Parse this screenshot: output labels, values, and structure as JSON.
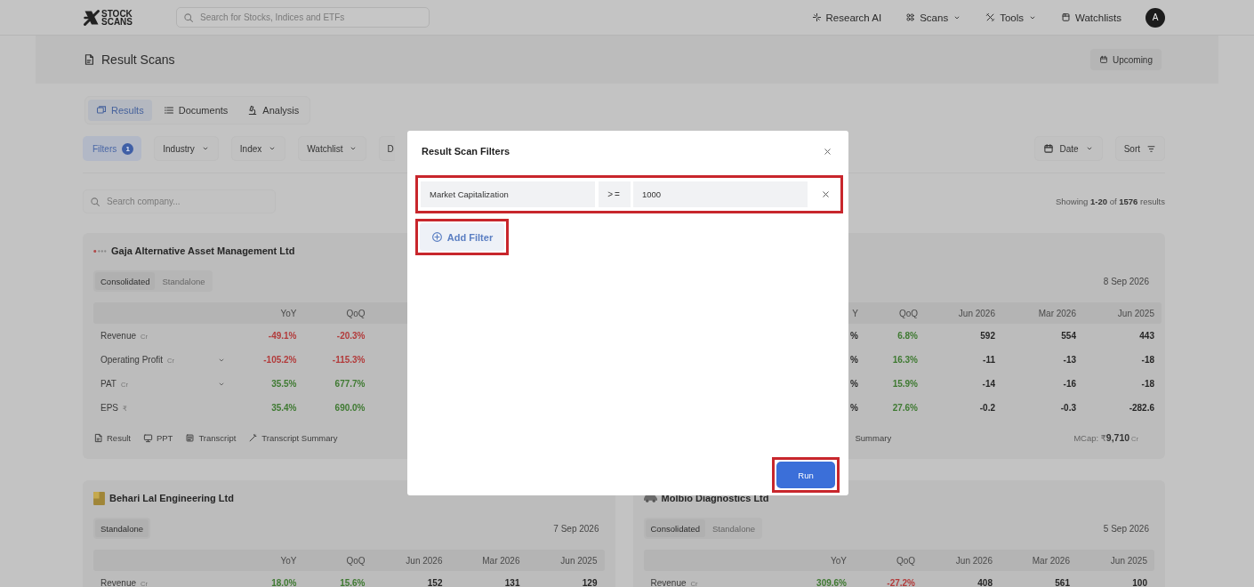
{
  "nav": {
    "logo": [
      "STOCK",
      "SCANS"
    ],
    "search_placeholder": "Search for Stocks, Indices and ETFs",
    "items": [
      {
        "label": "Research AI",
        "kind": "ai",
        "dropdown": false
      },
      {
        "label": "Scans",
        "kind": "scans",
        "dropdown": true
      },
      {
        "label": "Tools",
        "kind": "tools",
        "dropdown": true
      },
      {
        "label": "Watchlists",
        "kind": "watchlists",
        "dropdown": false
      }
    ],
    "avatar": "A"
  },
  "page_header": {
    "title": "Result Scans",
    "upcoming_button": "Upcoming"
  },
  "tabs": [
    {
      "label": "Results",
      "kind": "results",
      "selected": true
    },
    {
      "label": "Documents",
      "kind": "documents",
      "selected": false
    },
    {
      "label": "Analysis",
      "kind": "analysis",
      "selected": false
    }
  ],
  "filter_bar": {
    "filters_label": "Filters",
    "filters_count": "1",
    "dropdowns": [
      {
        "label": "Industry",
        "truncated": false
      },
      {
        "label": "Index",
        "truncated": false
      },
      {
        "label": "Watchlist",
        "truncated": false
      },
      {
        "label": "D",
        "truncated": true
      }
    ],
    "date_button": "Date",
    "sort_button": "Sort"
  },
  "search": {
    "placeholder": "Search company..."
  },
  "results_summary": "Showing **1-20** of **1576** results",
  "cards": [
    {
      "name": "Gaja Alternative Asset Management Ltd",
      "toggles": [
        {
          "label": "Consolidated",
          "selected": true
        },
        {
          "label": "Standalone",
          "selected": false
        }
      ],
      "columns": [
        "YoY",
        "QoQ"
      ],
      "rows": [
        {
          "label": "Revenue",
          "unit": "Cr",
          "expandable": false,
          "cells": [
            {
              "text": "-49.1%",
              "color": "#b23b3b"
            },
            {
              "text": "-20.3%",
              "color": "#b23b3b"
            }
          ]
        },
        {
          "label": "Operating Profit",
          "unit": "Cr",
          "expandable": true,
          "cells": [
            {
              "text": "-105.2%",
              "color": "#b23b3b"
            },
            {
              "text": "-115.3%",
              "color": "#b23b3b"
            }
          ]
        },
        {
          "label": "PAT",
          "unit": "Cr",
          "expandable": true,
          "cells": [
            {
              "text": "35.5%",
              "color": "#3f7a32"
            },
            {
              "text": "677.7%",
              "color": "#3f7a32"
            }
          ]
        },
        {
          "label": "EPS",
          "unit": "₹",
          "expandable": false,
          "cells": [
            {
              "text": "35.4%",
              "color": "#3f7a32"
            },
            {
              "text": "690.0%",
              "color": "#3f7a32"
            }
          ]
        }
      ],
      "footer_links": [
        {
          "label": "Result",
          "kind": "result"
        },
        {
          "label": "PPT",
          "kind": "ppt"
        },
        {
          "label": "Transcript",
          "kind": "transcript"
        },
        {
          "label": "Transcript Summary",
          "kind": "summary"
        }
      ]
    },
    {
      "date": "8 Sep 2026",
      "columns": [
        "Y",
        "QoQ",
        "Jun 2026",
        "Mar 2026",
        "Jun 2025"
      ],
      "rows": [
        {
          "cells": [
            {
              "text": "%"
            },
            {
              "text": "6.8%",
              "color": "#3f7a32"
            },
            {
              "text": "592",
              "color": "#262626"
            },
            {
              "text": "554",
              "color": "#262626"
            },
            {
              "text": "443",
              "color": "#262626"
            }
          ]
        },
        {
          "cells": [
            {
              "text": "%"
            },
            {
              "text": "16.3%",
              "color": "#3f7a32"
            },
            {
              "text": "-11",
              "color": "#262626"
            },
            {
              "text": "-13",
              "color": "#262626"
            },
            {
              "text": "-18",
              "color": "#262626"
            }
          ]
        },
        {
          "cells": [
            {
              "text": "%"
            },
            {
              "text": "15.9%",
              "color": "#3f7a32"
            },
            {
              "text": "-14",
              "color": "#262626"
            },
            {
              "text": "-16",
              "color": "#262626"
            },
            {
              "text": "-18",
              "color": "#262626"
            }
          ]
        },
        {
          "cells": [
            {
              "text": "%"
            },
            {
              "text": "27.6%",
              "color": "#3f7a32"
            },
            {
              "text": "-0.2",
              "color": "#262626"
            },
            {
              "text": "-0.3",
              "color": "#262626"
            },
            {
              "text": "-282.6",
              "color": "#262626"
            }
          ]
        }
      ],
      "footer_links": [
        {
          "label": "Summary",
          "kind": "cut"
        }
      ],
      "mcap": "MCap: ₹**9,710**",
      "mcap_unit": "Cr"
    },
    {
      "name": "Behari Lal Engineering Ltd",
      "toggles": [
        {
          "label": "Standalone",
          "selected": true
        }
      ],
      "date": "7 Sep 2026",
      "columns": [
        "YoY",
        "QoQ",
        "Jun 2026",
        "Mar 2026",
        "Jun 2025"
      ],
      "rows": [
        {
          "label": "Revenue",
          "unit": "Cr",
          "expandable": false,
          "cells": [
            {
              "text": "18.0%",
              "color": "#3f7a32"
            },
            {
              "text": "15.6%",
              "color": "#3f7a32"
            },
            {
              "text": "152",
              "color": "#262626"
            },
            {
              "text": "131",
              "color": "#262626"
            },
            {
              "text": "129",
              "color": "#262626"
            }
          ]
        }
      ]
    },
    {
      "name": "Molbio Diagnostics Ltd",
      "toggles": [
        {
          "label": "Consolidated",
          "selected": true
        },
        {
          "label": "Standalone",
          "selected": false
        }
      ],
      "date": "5 Sep 2026",
      "columns": [
        "YoY",
        "QoQ",
        "Jun 2026",
        "Mar 2026",
        "Jun 2025"
      ],
      "rows": [
        {
          "label": "Revenue",
          "unit": "Cr",
          "expandable": false,
          "cells": [
            {
              "text": "309.6%",
              "color": "#3f7a32"
            },
            {
              "text": "-27.2%",
              "color": "#b23b3b"
            },
            {
              "text": "408",
              "color": "#262626"
            },
            {
              "text": "561",
              "color": "#262626"
            },
            {
              "text": "100",
              "color": "#262626"
            }
          ]
        }
      ]
    }
  ],
  "modal": {
    "title": "Result Scan Filters",
    "filters": [
      {
        "field": "Market Capitalization",
        "operator": ">=",
        "value": "1000",
        "highlighted": true
      }
    ],
    "add_button": {
      "label": "Add Filter",
      "highlighted": true
    },
    "run_button": {
      "label": "Run",
      "highlighted": true
    }
  }
}
